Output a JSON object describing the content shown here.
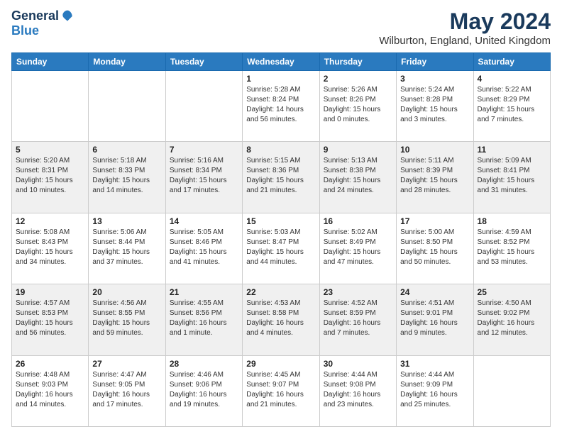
{
  "header": {
    "logo_general": "General",
    "logo_blue": "Blue",
    "title": "May 2024",
    "subtitle": "Wilburton, England, United Kingdom"
  },
  "days_of_week": [
    "Sunday",
    "Monday",
    "Tuesday",
    "Wednesday",
    "Thursday",
    "Friday",
    "Saturday"
  ],
  "weeks": [
    [
      {
        "day": "",
        "info": ""
      },
      {
        "day": "",
        "info": ""
      },
      {
        "day": "",
        "info": ""
      },
      {
        "day": "1",
        "info": "Sunrise: 5:28 AM\nSunset: 8:24 PM\nDaylight: 14 hours\nand 56 minutes."
      },
      {
        "day": "2",
        "info": "Sunrise: 5:26 AM\nSunset: 8:26 PM\nDaylight: 15 hours\nand 0 minutes."
      },
      {
        "day": "3",
        "info": "Sunrise: 5:24 AM\nSunset: 8:28 PM\nDaylight: 15 hours\nand 3 minutes."
      },
      {
        "day": "4",
        "info": "Sunrise: 5:22 AM\nSunset: 8:29 PM\nDaylight: 15 hours\nand 7 minutes."
      }
    ],
    [
      {
        "day": "5",
        "info": "Sunrise: 5:20 AM\nSunset: 8:31 PM\nDaylight: 15 hours\nand 10 minutes."
      },
      {
        "day": "6",
        "info": "Sunrise: 5:18 AM\nSunset: 8:33 PM\nDaylight: 15 hours\nand 14 minutes."
      },
      {
        "day": "7",
        "info": "Sunrise: 5:16 AM\nSunset: 8:34 PM\nDaylight: 15 hours\nand 17 minutes."
      },
      {
        "day": "8",
        "info": "Sunrise: 5:15 AM\nSunset: 8:36 PM\nDaylight: 15 hours\nand 21 minutes."
      },
      {
        "day": "9",
        "info": "Sunrise: 5:13 AM\nSunset: 8:38 PM\nDaylight: 15 hours\nand 24 minutes."
      },
      {
        "day": "10",
        "info": "Sunrise: 5:11 AM\nSunset: 8:39 PM\nDaylight: 15 hours\nand 28 minutes."
      },
      {
        "day": "11",
        "info": "Sunrise: 5:09 AM\nSunset: 8:41 PM\nDaylight: 15 hours\nand 31 minutes."
      }
    ],
    [
      {
        "day": "12",
        "info": "Sunrise: 5:08 AM\nSunset: 8:43 PM\nDaylight: 15 hours\nand 34 minutes."
      },
      {
        "day": "13",
        "info": "Sunrise: 5:06 AM\nSunset: 8:44 PM\nDaylight: 15 hours\nand 37 minutes."
      },
      {
        "day": "14",
        "info": "Sunrise: 5:05 AM\nSunset: 8:46 PM\nDaylight: 15 hours\nand 41 minutes."
      },
      {
        "day": "15",
        "info": "Sunrise: 5:03 AM\nSunset: 8:47 PM\nDaylight: 15 hours\nand 44 minutes."
      },
      {
        "day": "16",
        "info": "Sunrise: 5:02 AM\nSunset: 8:49 PM\nDaylight: 15 hours\nand 47 minutes."
      },
      {
        "day": "17",
        "info": "Sunrise: 5:00 AM\nSunset: 8:50 PM\nDaylight: 15 hours\nand 50 minutes."
      },
      {
        "day": "18",
        "info": "Sunrise: 4:59 AM\nSunset: 8:52 PM\nDaylight: 15 hours\nand 53 minutes."
      }
    ],
    [
      {
        "day": "19",
        "info": "Sunrise: 4:57 AM\nSunset: 8:53 PM\nDaylight: 15 hours\nand 56 minutes."
      },
      {
        "day": "20",
        "info": "Sunrise: 4:56 AM\nSunset: 8:55 PM\nDaylight: 15 hours\nand 59 minutes."
      },
      {
        "day": "21",
        "info": "Sunrise: 4:55 AM\nSunset: 8:56 PM\nDaylight: 16 hours\nand 1 minute."
      },
      {
        "day": "22",
        "info": "Sunrise: 4:53 AM\nSunset: 8:58 PM\nDaylight: 16 hours\nand 4 minutes."
      },
      {
        "day": "23",
        "info": "Sunrise: 4:52 AM\nSunset: 8:59 PM\nDaylight: 16 hours\nand 7 minutes."
      },
      {
        "day": "24",
        "info": "Sunrise: 4:51 AM\nSunset: 9:01 PM\nDaylight: 16 hours\nand 9 minutes."
      },
      {
        "day": "25",
        "info": "Sunrise: 4:50 AM\nSunset: 9:02 PM\nDaylight: 16 hours\nand 12 minutes."
      }
    ],
    [
      {
        "day": "26",
        "info": "Sunrise: 4:48 AM\nSunset: 9:03 PM\nDaylight: 16 hours\nand 14 minutes."
      },
      {
        "day": "27",
        "info": "Sunrise: 4:47 AM\nSunset: 9:05 PM\nDaylight: 16 hours\nand 17 minutes."
      },
      {
        "day": "28",
        "info": "Sunrise: 4:46 AM\nSunset: 9:06 PM\nDaylight: 16 hours\nand 19 minutes."
      },
      {
        "day": "29",
        "info": "Sunrise: 4:45 AM\nSunset: 9:07 PM\nDaylight: 16 hours\nand 21 minutes."
      },
      {
        "day": "30",
        "info": "Sunrise: 4:44 AM\nSunset: 9:08 PM\nDaylight: 16 hours\nand 23 minutes."
      },
      {
        "day": "31",
        "info": "Sunrise: 4:44 AM\nSunset: 9:09 PM\nDaylight: 16 hours\nand 25 minutes."
      },
      {
        "day": "",
        "info": ""
      }
    ]
  ]
}
